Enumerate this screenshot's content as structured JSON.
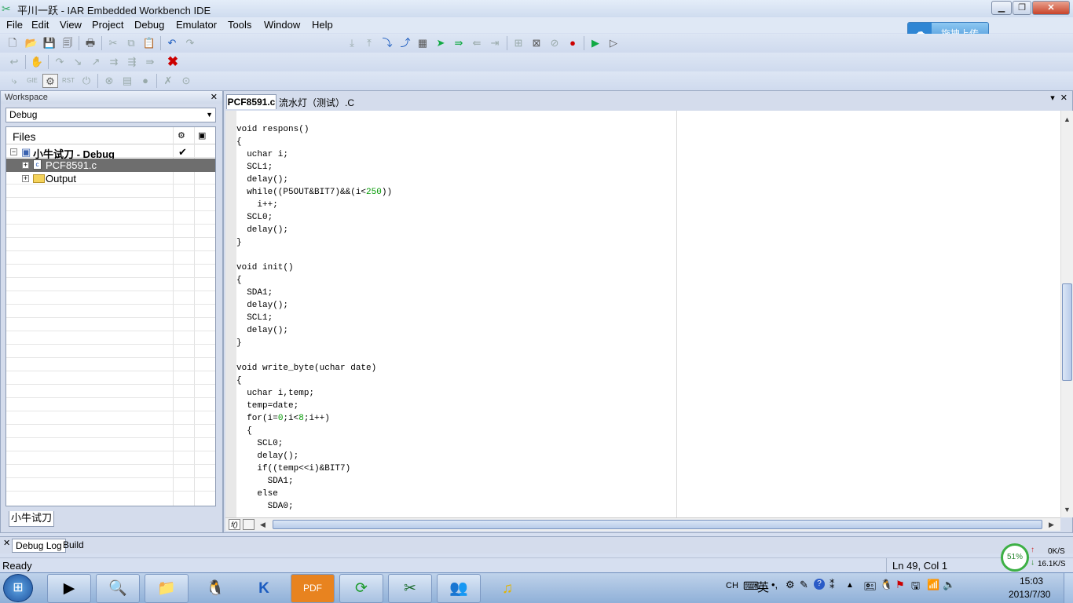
{
  "window": {
    "title": "平川一跃 - IAR Embedded Workbench IDE"
  },
  "menu": [
    "File",
    "Edit",
    "View",
    "Project",
    "Debug",
    "Emulator",
    "Tools",
    "Window",
    "Help"
  ],
  "upload_button": {
    "label": "拖拽上传"
  },
  "workspace": {
    "title": "Workspace",
    "config": "Debug",
    "files_header": "Files",
    "project": "小牛试刀 - Debug",
    "project_check": "✔",
    "items": [
      {
        "name": "PCF8591.c",
        "selected": true
      },
      {
        "name": "Output",
        "selected": false
      }
    ],
    "tab": "小牛试刀"
  },
  "editor": {
    "tabs": [
      {
        "label": "PCF8591.c",
        "active": true
      },
      {
        "label": "流水灯（测试）.C",
        "active": false
      }
    ],
    "code_lines": [
      "void respons()",
      "{",
      "  uchar i;",
      "  SCL1;",
      "  delay();",
      "  while((P5OUT&BIT7)&&(i<250))",
      "    i++;",
      "  SCL0;",
      "  delay();",
      "}",
      "",
      "void init()",
      "{",
      "  SDA1;",
      "  delay();",
      "  SCL1;",
      "  delay();",
      "}",
      "",
      "void write_byte(uchar date)",
      "{",
      "  uchar i,temp;",
      "  temp=date;",
      "  for(i=0;i<8;i++)",
      "  {",
      "    SCL0;",
      "    delay();",
      "    if((temp<<i)&BIT7)",
      "      SDA1;",
      "    else",
      "      SDA0;"
    ],
    "func_button": "f()"
  },
  "bottom_tabs": [
    "Debug Log",
    "Build"
  ],
  "status": {
    "left": "Ready",
    "position": "Ln 49, Col 1"
  },
  "network": {
    "percent": "51%",
    "up": "0K/S",
    "down": "16.1K/S"
  },
  "tray": {
    "lang": "CH",
    "ime": "英",
    "time": "15:03",
    "date": "2013/7/30"
  },
  "taskbar_apps": [
    "media-player-icon",
    "magnifier-icon",
    "file-explorer-icon",
    "qq-icon",
    "kuwo-icon",
    "pdf-icon",
    "refresh-icon",
    "iar-icon",
    "contacts-icon",
    "music-icon"
  ]
}
